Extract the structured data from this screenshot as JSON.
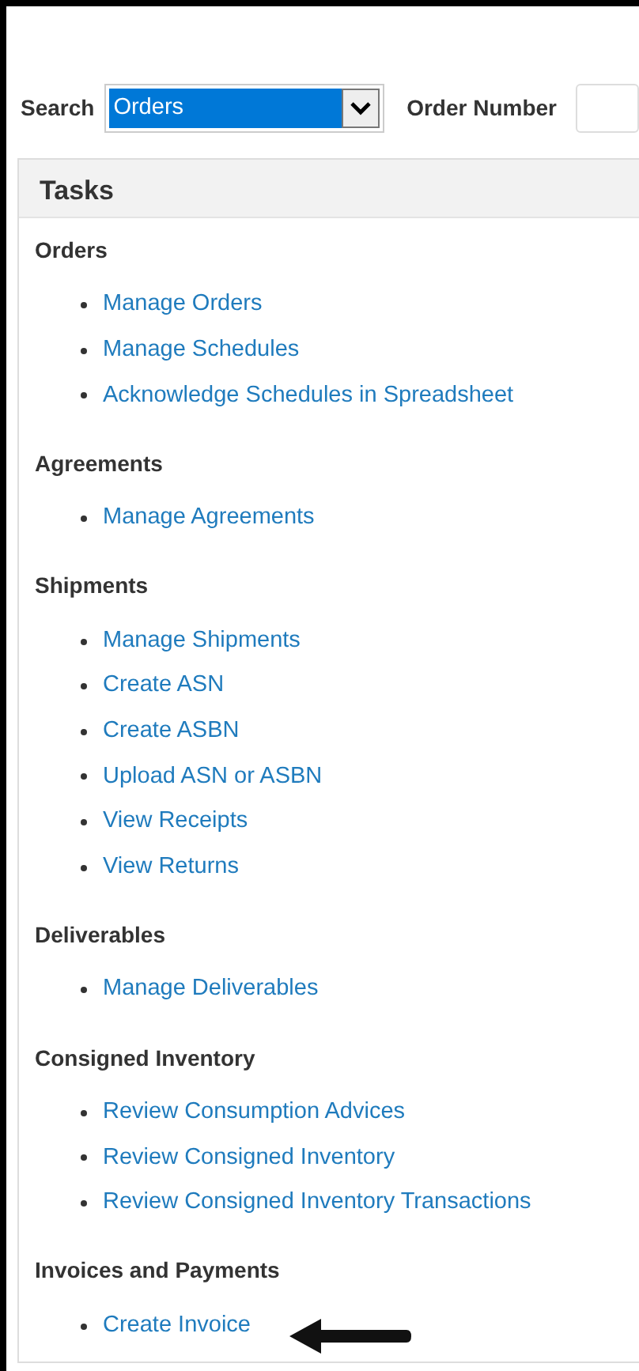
{
  "search": {
    "label": "Search",
    "value": "Orders",
    "field_label": "Order Number"
  },
  "tasks": {
    "title": "Tasks",
    "sections": [
      {
        "title": "Orders",
        "links": [
          "Manage Orders",
          "Manage Schedules",
          "Acknowledge Schedules in Spreadsheet"
        ]
      },
      {
        "title": "Agreements",
        "links": [
          "Manage Agreements"
        ]
      },
      {
        "title": "Shipments",
        "links": [
          "Manage Shipments",
          "Create ASN",
          "Create ASBN",
          "Upload ASN or ASBN",
          "View Receipts",
          "View Returns"
        ]
      },
      {
        "title": "Deliverables",
        "links": [
          "Manage Deliverables"
        ]
      },
      {
        "title": "Consigned Inventory",
        "links": [
          "Review Consumption Advices",
          "Review Consigned Inventory",
          "Review Consigned Inventory Transactions"
        ]
      },
      {
        "title": "Invoices and Payments",
        "links": [
          "Create Invoice"
        ]
      }
    ]
  },
  "annotation": {
    "kind": "arrow"
  }
}
